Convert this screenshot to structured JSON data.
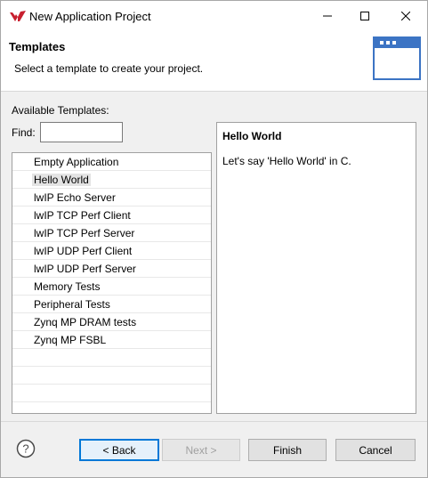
{
  "window": {
    "title": "New Application Project"
  },
  "header": {
    "title": "Templates",
    "description": "Select a template to create your project."
  },
  "available_label": "Available Templates:",
  "find": {
    "label": "Find:",
    "value": ""
  },
  "templates": [
    "Empty Application",
    "Hello World",
    "lwIP Echo Server",
    "lwIP TCP Perf Client",
    "lwIP TCP Perf Server",
    "lwIP UDP Perf Client",
    "lwIP UDP Perf Server",
    "Memory Tests",
    "Peripheral Tests",
    "Zynq MP DRAM tests",
    "Zynq MP FSBL"
  ],
  "selected_template": "Hello World",
  "description_panel": {
    "title": "Hello World",
    "text": "Let's say 'Hello World' in C."
  },
  "buttons": {
    "back": "< Back",
    "next": "Next >",
    "finish": "Finish",
    "cancel": "Cancel"
  },
  "icons": {
    "app": "xilinx-logo-icon",
    "minimize": "minimize-icon",
    "maximize": "maximize-icon",
    "close": "close-icon",
    "wizard": "wizard-window-icon",
    "help": "help-icon"
  },
  "colors": {
    "accent": "#0078d7",
    "logo": "#c8202f",
    "wizard_icon": "#3c74c4"
  }
}
